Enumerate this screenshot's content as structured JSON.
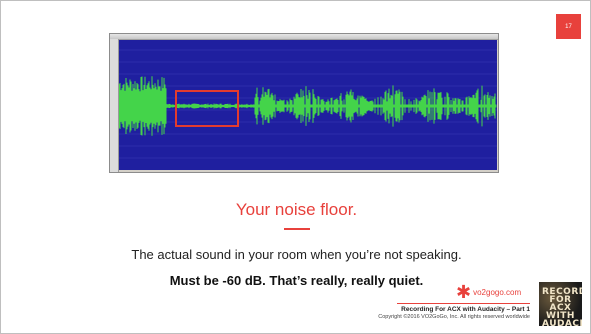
{
  "slide": {
    "page_number": "17",
    "title": "Your noise floor.",
    "body": "The actual sound in your room when you’re not speaking.",
    "emphasis": "Must be -60 dB. That’s really, really quiet.",
    "brand": "vo2gogo.com",
    "footer_title": "Recording For ACX with Audacity – Part 1",
    "footer_copyright": "Copyright ©2016 VO2GoGo, Inc. All rights reserved worldwide",
    "book_cover_text": "RECORDING FOR ACX WITH AUDACITY"
  },
  "colors": {
    "accent": "#e8413c",
    "waveform_bg": "#1f1f9f",
    "waveform_green": "#44d44a"
  },
  "icons": {
    "brand_logo": "red-star-icon"
  }
}
